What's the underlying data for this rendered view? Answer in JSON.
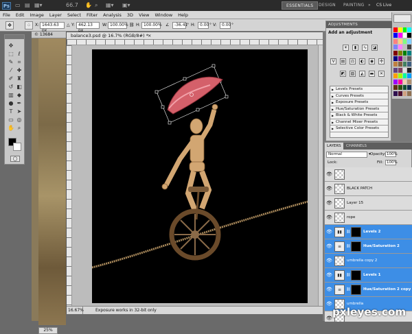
{
  "titlebar": {
    "app_icon": "Ps",
    "zoom": "66.7",
    "workspaces": [
      "ESSENTIALS",
      "DESIGN",
      "PAINTING"
    ],
    "more": "»",
    "cs_live": "CS Live"
  },
  "menu": [
    "File",
    "Edit",
    "Image",
    "Layer",
    "Select",
    "Filter",
    "Analysis",
    "3D",
    "View",
    "Window",
    "Help"
  ],
  "options": {
    "x_label": "X:",
    "x_value": "1643.63 px",
    "y_label": "Y:",
    "y_value": "462.13 px",
    "w_label": "W:",
    "w_value": "100.00%",
    "h_label": "H:",
    "h_value": "100.00%",
    "angle_value": "-36.41",
    "hskew_label": "H:",
    "hskew_value": "0.00",
    "vskew_label": "V:",
    "vskew_value": "0.00",
    "degree": "°"
  },
  "bg_document": {
    "tab": "© 13684",
    "zoom": "25%"
  },
  "document": {
    "tab_title": "balance3.psd @ 16.7% (RGB/8#) *",
    "zoom": "16.67%",
    "status": "Exposure works in 32-bit only"
  },
  "adjustments": {
    "title": "ADJUSTMENTS",
    "subtitle": "Add an adjustment",
    "presets": [
      "Levels Presets",
      "Curves Presets",
      "Exposure Presets",
      "Hue/Saturation Presets",
      "Black & White Presets",
      "Channel Mixer Presets",
      "Selective Color Presets"
    ]
  },
  "layers_panel": {
    "tabs": [
      "LAYERS",
      "CHANNELS"
    ],
    "blend_mode": "Normal",
    "opacity_label": "Opacity:",
    "opacity": "100%",
    "fill_label": "Fill:",
    "fill": "100%",
    "lock_label": "Lock:",
    "layers": [
      {
        "name": "",
        "type": "pixel",
        "selected": false
      },
      {
        "name": "BLACK PATCH",
        "type": "pixel",
        "selected": false
      },
      {
        "name": "Layer 15",
        "type": "pixel",
        "selected": false
      },
      {
        "name": "rope",
        "type": "pixel",
        "selected": false
      },
      {
        "name": "Levels 2",
        "type": "levels",
        "selected": true
      },
      {
        "name": "Hue/Saturation 2",
        "type": "huesat",
        "selected": true
      },
      {
        "name": "umbrella copy 2",
        "type": "pixel",
        "selected": true
      },
      {
        "name": "Levels 1",
        "type": "levels",
        "selected": true
      },
      {
        "name": "Hue/Saturation 2 copy",
        "type": "huesat",
        "selected": true
      },
      {
        "name": "umbrella",
        "type": "pixel",
        "selected": true
      },
      {
        "name": "",
        "type": "pixel",
        "selected": false
      }
    ]
  },
  "watermark": "pxleyes.com",
  "colors": {
    "selection": "#3d8ee6",
    "umbrella": "#d4606a",
    "wood": "#d2a672"
  }
}
